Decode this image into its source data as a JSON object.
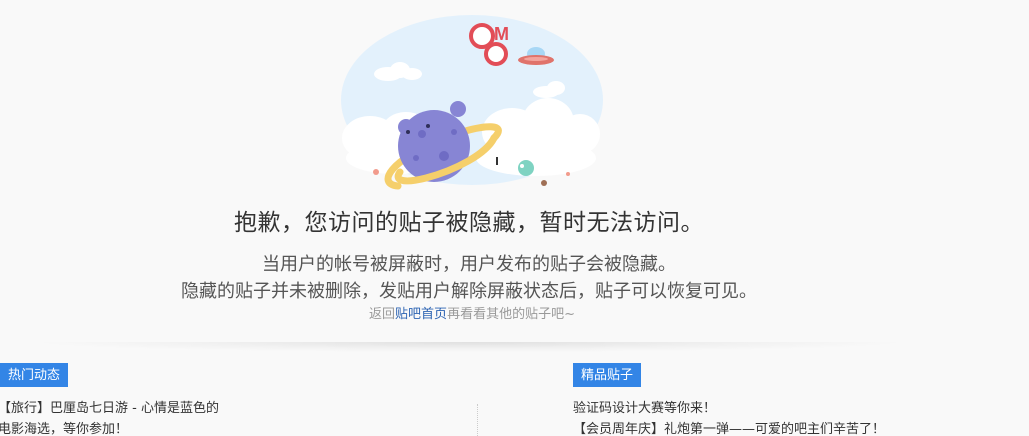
{
  "colors": {
    "accent": "#3385e6",
    "link": "#2d64b3",
    "planet": "#8785d4",
    "ring": "#f5cf6b",
    "sky": "#e3f1fc"
  },
  "illustration": {
    "badge_letters": [
      "O",
      "M",
      "G"
    ],
    "icons": [
      "omg-badge-icon",
      "ufo-icon",
      "planet-icon",
      "cloud-icon"
    ]
  },
  "notice": {
    "headline": "抱歉，您访问的贴子被隐藏，暂时无法访问。",
    "line1": "当用户的帐号被屏蔽时，用户发布的贴子会被隐藏。",
    "line2": "隐藏的贴子并未被删除，发贴用户解除屏蔽状态后，贴子可以恢复可见。",
    "back_prefix": "返回",
    "back_link": "贴吧首页",
    "back_suffix": "再看看其他的贴子吧~"
  },
  "hot": {
    "label": "热门动态",
    "items": [
      "【旅行】巴厘岛七日游 - 心情是蓝色的",
      "电影海选，等你参加！"
    ]
  },
  "featured": {
    "label": "精品贴子",
    "items": [
      "验证码设计大赛等你来！",
      "【会员周年庆】礼炮第一弹——可爱的吧主们辛苦了！"
    ]
  }
}
